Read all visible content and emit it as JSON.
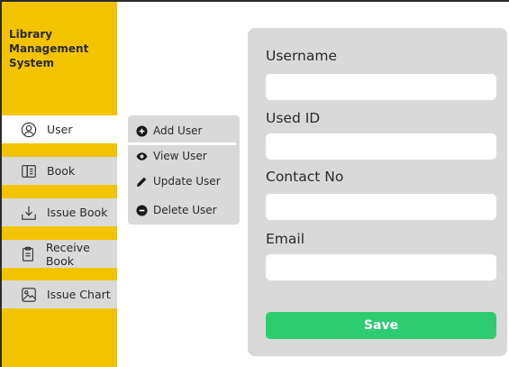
{
  "app": {
    "title": "Library\nManagement\nSystem"
  },
  "sidebar": {
    "items": [
      {
        "label": "User",
        "icon": "user-icon",
        "active": true
      },
      {
        "label": "Book",
        "icon": "book-icon"
      },
      {
        "label": "Issue Book",
        "icon": "download-icon"
      },
      {
        "label": "Receive Book",
        "icon": "clipboard-icon"
      },
      {
        "label": "Issue Chart",
        "icon": "image-icon"
      }
    ]
  },
  "submenu": {
    "items": [
      {
        "label": "Add User",
        "icon": "plus-circle-icon"
      },
      {
        "label": "View User",
        "icon": "eye-icon"
      },
      {
        "label": "Update User",
        "icon": "pencil-icon"
      },
      {
        "label": "Delete User",
        "icon": "minus-circle-icon"
      }
    ]
  },
  "form": {
    "fields": [
      {
        "label": "Username",
        "value": "",
        "placeholder": ""
      },
      {
        "label": "Used ID",
        "value": "",
        "placeholder": ""
      },
      {
        "label": "Contact No",
        "value": "",
        "placeholder": ""
      },
      {
        "label": "Email",
        "value": "",
        "placeholder": ""
      }
    ],
    "save_label": "Save"
  },
  "colors": {
    "sidebar": "#f2c400",
    "panel": "#d9d9d9",
    "accent_green": "#2ecc71",
    "text": "#2a2a2a"
  }
}
